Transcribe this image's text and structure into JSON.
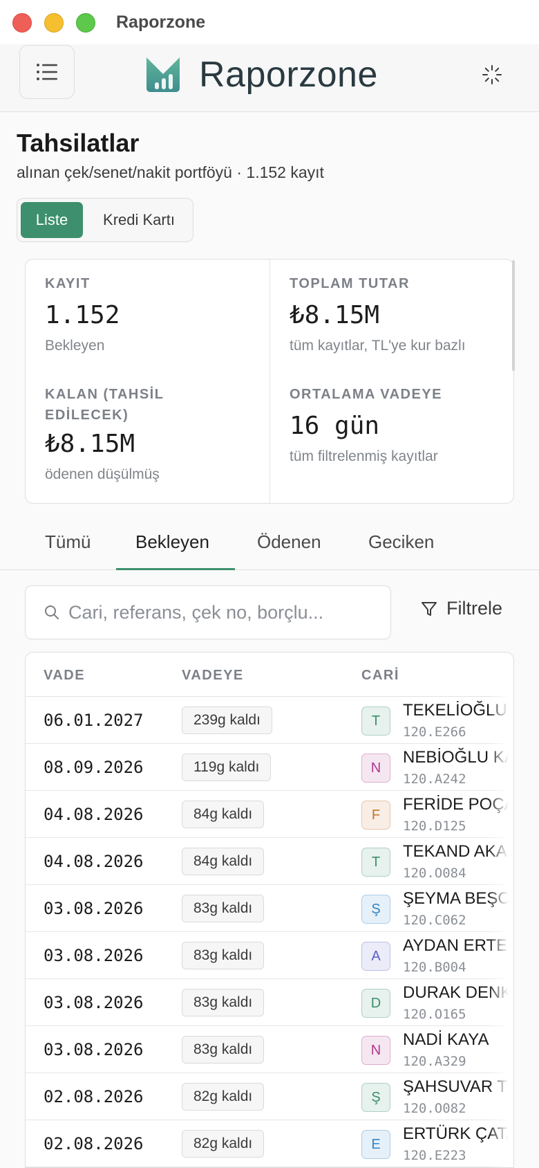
{
  "window": {
    "title": "Raporzone"
  },
  "header": {
    "brand": "Raporzone",
    "menu_icon": "menu-icon",
    "theme_icon": "sun-icon"
  },
  "page": {
    "title": "Tahsilatlar",
    "subtitle": "alınan çek/senet/nakit portföyü · 1.152 kayıt",
    "view_toggle": {
      "active": "Liste",
      "inactive": "Kredi Kartı"
    }
  },
  "stats": [
    {
      "label": "KAYIT",
      "value": "1.152",
      "hint": "Bekleyen"
    },
    {
      "label": "TOPLAM TUTAR",
      "value": "₺8.15M",
      "hint": "tüm kayıtlar, TL'ye kur bazlı"
    },
    {
      "label": "KALAN (TAHSİL EDİLECEK)",
      "value": "₺8.15M",
      "hint": "ödenen düşülmüş"
    },
    {
      "label": "ORTALAMA VADEYE",
      "value": "16 gün",
      "hint": "tüm filtrelenmiş kayıtlar"
    }
  ],
  "tabs": [
    "Tümü",
    "Bekleyen",
    "Ödenen",
    "Geciken"
  ],
  "active_tab": "Bekleyen",
  "search": {
    "placeholder": "Cari, referans, çek no, borçlu...",
    "value": ""
  },
  "filter": {
    "label": "Filtrele"
  },
  "table": {
    "columns": [
      "VADE",
      "VADEYE",
      "CARİ"
    ],
    "rows": [
      {
        "vade": "06.01.2027",
        "vadeye": "239g kaldı",
        "initial": "T",
        "name": "TEKELİOĞLU İ",
        "code": "120.E266",
        "color": "#3a8f6a"
      },
      {
        "vade": "08.09.2026",
        "vadeye": "119g kaldı",
        "initial": "N",
        "name": "NEBİOĞLU KA",
        "code": "120.A242",
        "color": "#b0378e"
      },
      {
        "vade": "04.08.2026",
        "vadeye": "84g kaldı",
        "initial": "F",
        "name": "FERİDE POÇA",
        "code": "120.D125",
        "color": "#c4752f"
      },
      {
        "vade": "04.08.2026",
        "vadeye": "84g kaldı",
        "initial": "T",
        "name": "TEKAND AKA",
        "code": "120.O084",
        "color": "#3a8f6a"
      },
      {
        "vade": "03.08.2026",
        "vadeye": "83g kaldı",
        "initial": "Ş",
        "name": "ŞEYMA BEŞO",
        "code": "120.C062",
        "color": "#3584c4"
      },
      {
        "vade": "03.08.2026",
        "vadeye": "83g kaldı",
        "initial": "A",
        "name": "AYDAN ERTEP",
        "code": "120.B004",
        "color": "#5a5fc8"
      },
      {
        "vade": "03.08.2026",
        "vadeye": "83g kaldı",
        "initial": "D",
        "name": "DURAK DENK",
        "code": "120.O165",
        "color": "#3a8f6a"
      },
      {
        "vade": "03.08.2026",
        "vadeye": "83g kaldı",
        "initial": "N",
        "name": "NADİ KAYA",
        "code": "120.A329",
        "color": "#b0378e"
      },
      {
        "vade": "02.08.2026",
        "vadeye": "82g kaldı",
        "initial": "Ş",
        "name": "ŞAHSUVAR TO",
        "code": "120.O082",
        "color": "#3a8f6a"
      },
      {
        "vade": "02.08.2026",
        "vadeye": "82g kaldı",
        "initial": "E",
        "name": "ERTÜRK ÇATA",
        "code": "120.E223",
        "color": "#3584c4"
      }
    ]
  }
}
